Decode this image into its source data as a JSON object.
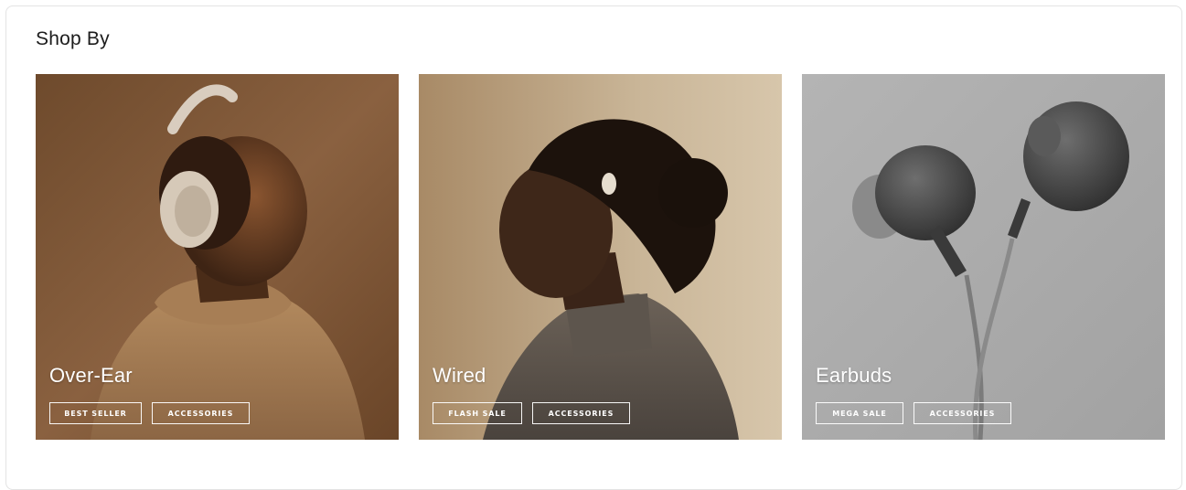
{
  "section": {
    "title": "Shop By"
  },
  "cards": [
    {
      "label": "Over-Ear",
      "tags": [
        "BEST SELLER",
        "ACCESSORIES"
      ]
    },
    {
      "label": "Wired",
      "tags": [
        "FLASH SALE",
        "ACCESSORIES"
      ]
    },
    {
      "label": "Earbuds",
      "tags": [
        "MEGA SALE",
        "ACCESSORIES"
      ]
    }
  ],
  "colors": {
    "card1_bg": "#7a5232",
    "card2_bg": "#b89a76",
    "card3_bg": "#a9a9a9",
    "tag_border": "#ffffff"
  }
}
